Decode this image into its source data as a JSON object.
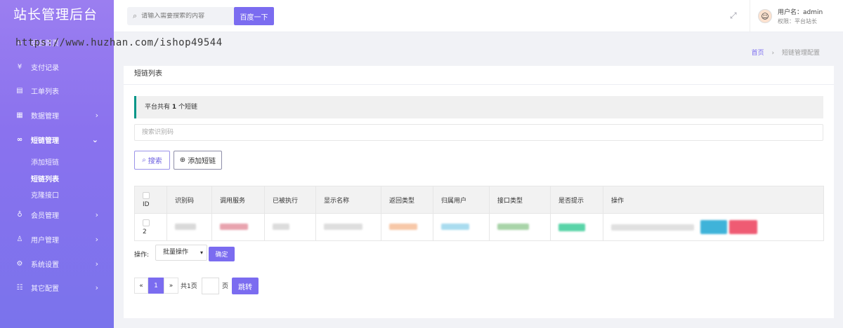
{
  "brand": "站长管理后台",
  "watermark": "https://www.huzhan.com/ishop49544",
  "sidebar": {
    "items": [
      {
        "icon": "home-icon",
        "glyph": "⌂",
        "label": "后台首页"
      },
      {
        "icon": "yen-icon",
        "glyph": "¥",
        "label": "支付记录"
      },
      {
        "icon": "ticket-icon",
        "glyph": "▤",
        "label": "工单列表"
      },
      {
        "icon": "data-icon",
        "glyph": "▦",
        "label": "数据管理"
      },
      {
        "icon": "link-icon",
        "glyph": "∞",
        "label": "短链管理"
      },
      {
        "icon": "member-icon",
        "glyph": "♁",
        "label": "会员管理"
      },
      {
        "icon": "user-icon",
        "glyph": "♙",
        "label": "用户管理"
      },
      {
        "icon": "settings-icon",
        "glyph": "⚙",
        "label": "系统设置"
      },
      {
        "icon": "other-icon",
        "glyph": "☷",
        "label": "其它配置"
      }
    ],
    "sub_items": [
      "添加短链",
      "短链列表",
      "克隆接口"
    ]
  },
  "header": {
    "search_placeholder": "请输入需要搜索的内容",
    "search_button": "百度一下",
    "user_name": "用户名：admin",
    "user_role": "权限：平台站长"
  },
  "breadcrumb": {
    "home": "首页",
    "current": "短链管理配置"
  },
  "card": {
    "title": "短链列表",
    "notice_prefix": "平台共有 ",
    "notice_count": "1",
    "notice_suffix": " 个短链",
    "keyword_placeholder": "搜索识别码",
    "search_button": "搜索",
    "add_button": "添加短链"
  },
  "table": {
    "headers": [
      "ID",
      "识别码",
      "调用服务",
      "已被执行",
      "显示名称",
      "返回类型",
      "归属用户",
      "接口类型",
      "是否提示",
      "操作"
    ],
    "rows": [
      {
        "id": "2"
      }
    ],
    "blur_colors": [
      "#d9d9d9",
      "#e8a3ae",
      "#d9d9d9",
      "#d9d9d9",
      "#f7c8a8",
      "#a9dcef",
      "#a8d4a8",
      "#59d4a8"
    ]
  },
  "batch": {
    "label": "操作:",
    "select_value": "批量操作",
    "confirm_button": "确定"
  },
  "pagination": {
    "prev": "«",
    "current": "1",
    "next": "»",
    "total": "共1页",
    "unit": "页",
    "go_button": "跳转"
  }
}
